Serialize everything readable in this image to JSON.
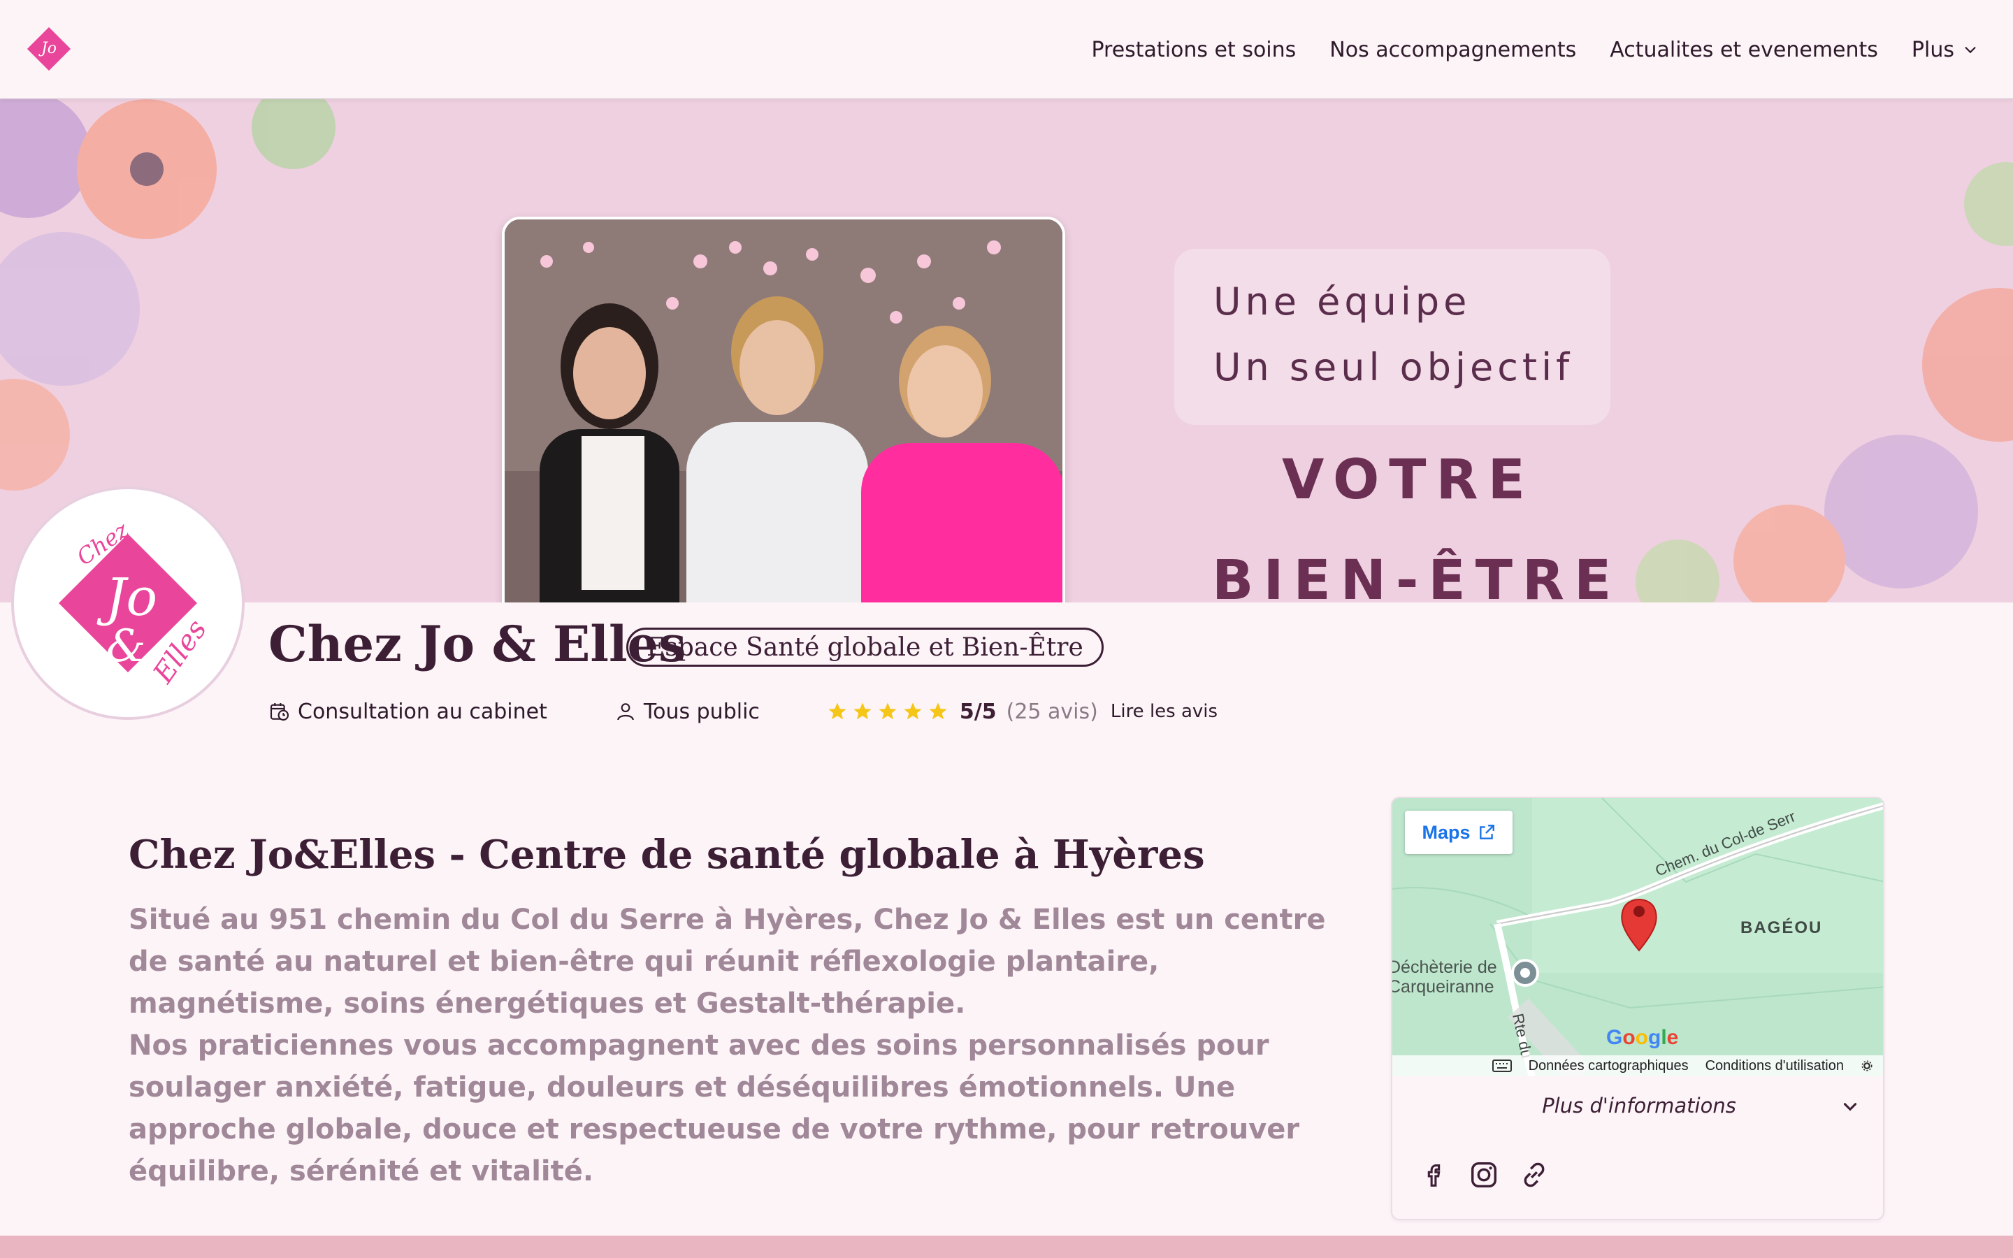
{
  "nav": {
    "logo_alt": "Chez Jo & Elles",
    "items": [
      {
        "label": "Prestations et soins"
      },
      {
        "label": "Nos accompagnements"
      },
      {
        "label": "Actualites et evenements"
      },
      {
        "label": "Plus"
      }
    ]
  },
  "banner": {
    "line1": "Une équipe",
    "line2": "Un seul objectif",
    "line3": "VOTRE",
    "line4": "BIEN-ÊTRE"
  },
  "profile": {
    "name": "Chez Jo & Elles",
    "badge": "Espace Santé globale et Bien-Être",
    "consultation": "Consultation au cabinet",
    "audience": "Tous public",
    "stars": 5,
    "rating": "5/5",
    "review_count": "(25 avis)",
    "reviews_link": "Lire les avis"
  },
  "main": {
    "title": "Chez Jo&Elles - Centre de santé globale à Hyères",
    "paragraph1": "Situé au 951 chemin du Col du Serre à Hyères, Chez Jo & Elles est un centre de santé au naturel et bien-être qui réunit réflexologie plantaire, magnétisme, soins énergétiques et Gestalt-thérapie.",
    "paragraph2": "Nos praticiennes vous accompagnent avec des soins personnalisés pour soulager anxiété, fatigue, douleurs et déséquilibres émotionnels. Une approche globale, douce et respectueuse de votre rythme, pour retrouver équilibre, sérénité et vitalité."
  },
  "map": {
    "maps_button": "Maps",
    "road_label": "Chem. du Col-de Serr",
    "area_label": "BAGÉOU",
    "poi_line1": "Déchèterie de",
    "poi_line2": "Carqueiranne",
    "road2_label": "Rte du",
    "google": "Google",
    "footer_data": "Données cartographiques",
    "footer_terms": "Conditions d'utilisation",
    "more_info": "Plus d'informations"
  },
  "socials": [
    "facebook-icon",
    "instagram-icon",
    "link-icon"
  ],
  "colors": {
    "brand_pink": "#e9459a",
    "banner_bg": "#efd0e0",
    "text_dark": "#3c1f35",
    "text_muted": "#a08898",
    "star": "#f5c518"
  }
}
